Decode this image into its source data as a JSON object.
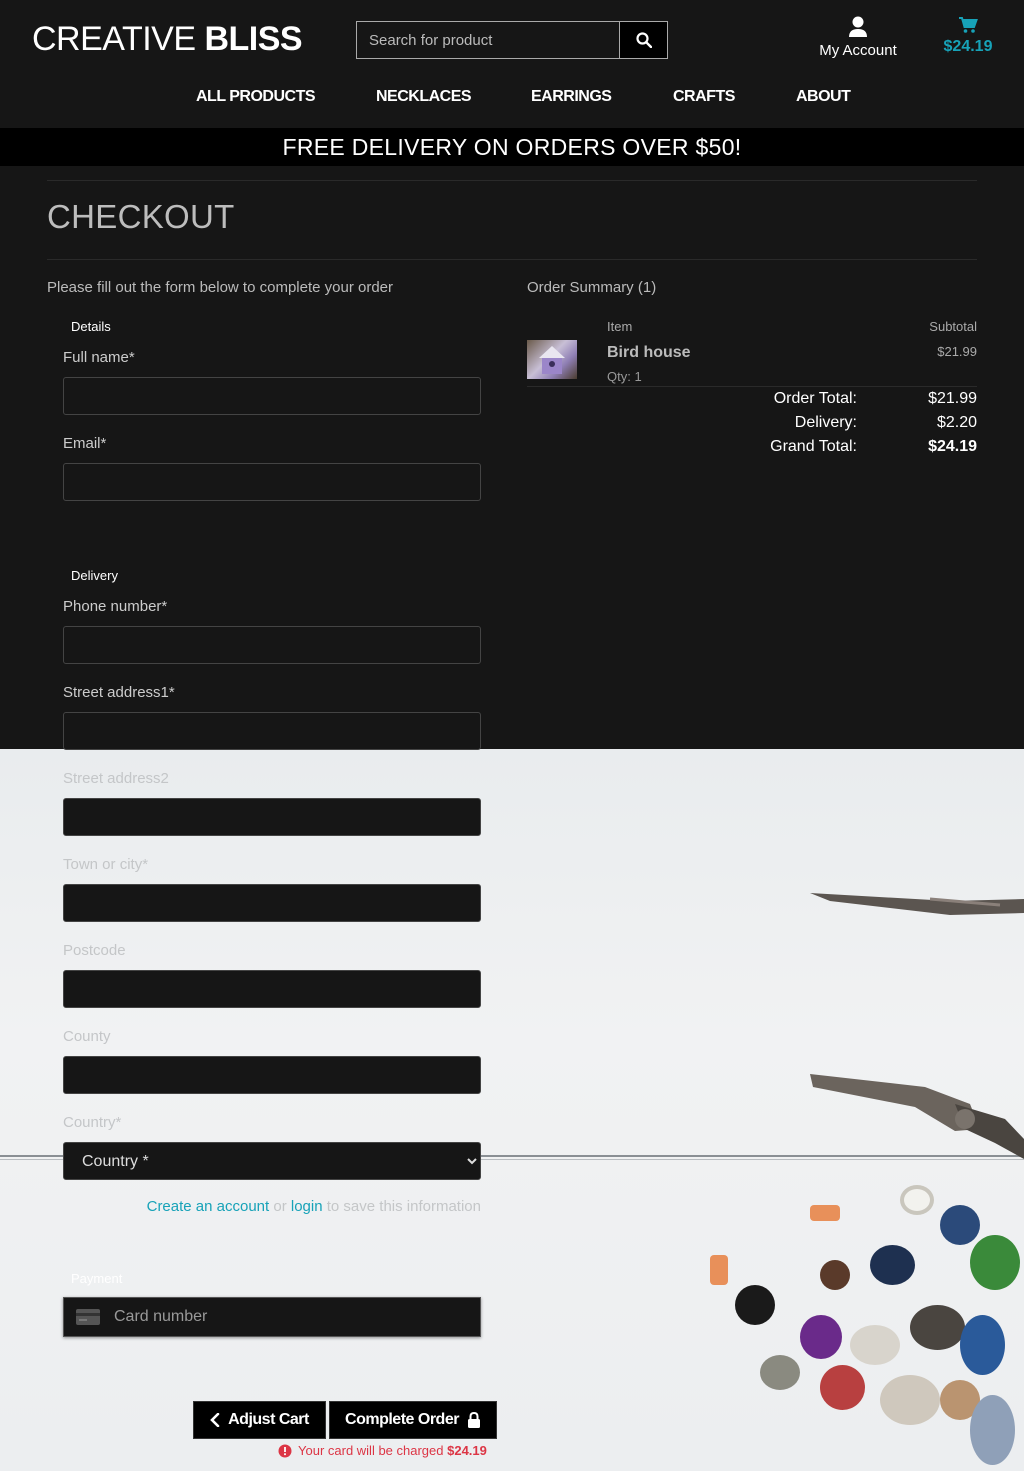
{
  "header": {
    "logo_light": "CREATIVE ",
    "logo_bold": "BLISS",
    "search_placeholder": "Search for product",
    "account_label": "My Account",
    "cart_total": "$24.19"
  },
  "nav": [
    "ALL PRODUCTS",
    "NECKLACES",
    "EARRINGS",
    "CRAFTS",
    "ABOUT"
  ],
  "banner": "FREE DELIVERY ON ORDERS OVER $50!",
  "page_title": "CHECKOUT",
  "form": {
    "intro": "Please fill out the form below to complete your order",
    "details_legend": "Details",
    "full_name_label": "Full name*",
    "email_label": "Email*",
    "delivery_legend": "Delivery",
    "phone_label": "Phone number*",
    "street1_label": "Street address1*",
    "street2_label": "Street address2",
    "town_label": "Town or city*",
    "postcode_label": "Postcode",
    "county_label": "County",
    "country_label": "Country*",
    "country_selected": "Country *",
    "save_create": "Create an account",
    "save_or": " or ",
    "save_login": "login",
    "save_rest": " to save this information",
    "payment_legend": "Payment",
    "card_placeholder": "Card number"
  },
  "summary": {
    "title": "Order Summary (1)",
    "col_item": "Item",
    "col_subtotal": "Subtotal",
    "item_name": "Bird house",
    "item_qty": "Qty: 1",
    "item_subtotal": "$21.99",
    "order_total_label": "Order Total:",
    "order_total": "$21.99",
    "delivery_label": "Delivery:",
    "delivery": "$2.20",
    "grand_total_label": "Grand Total:",
    "grand_total": "$24.19"
  },
  "buttons": {
    "adjust_cart": "Adjust Cart",
    "complete_order": "Complete Order"
  },
  "charge_notice": {
    "text": "Your card will be charged ",
    "amount": "$24.19"
  },
  "colors": {
    "accent": "#17a2b8",
    "danger": "#dc3545",
    "background": "#161616"
  }
}
